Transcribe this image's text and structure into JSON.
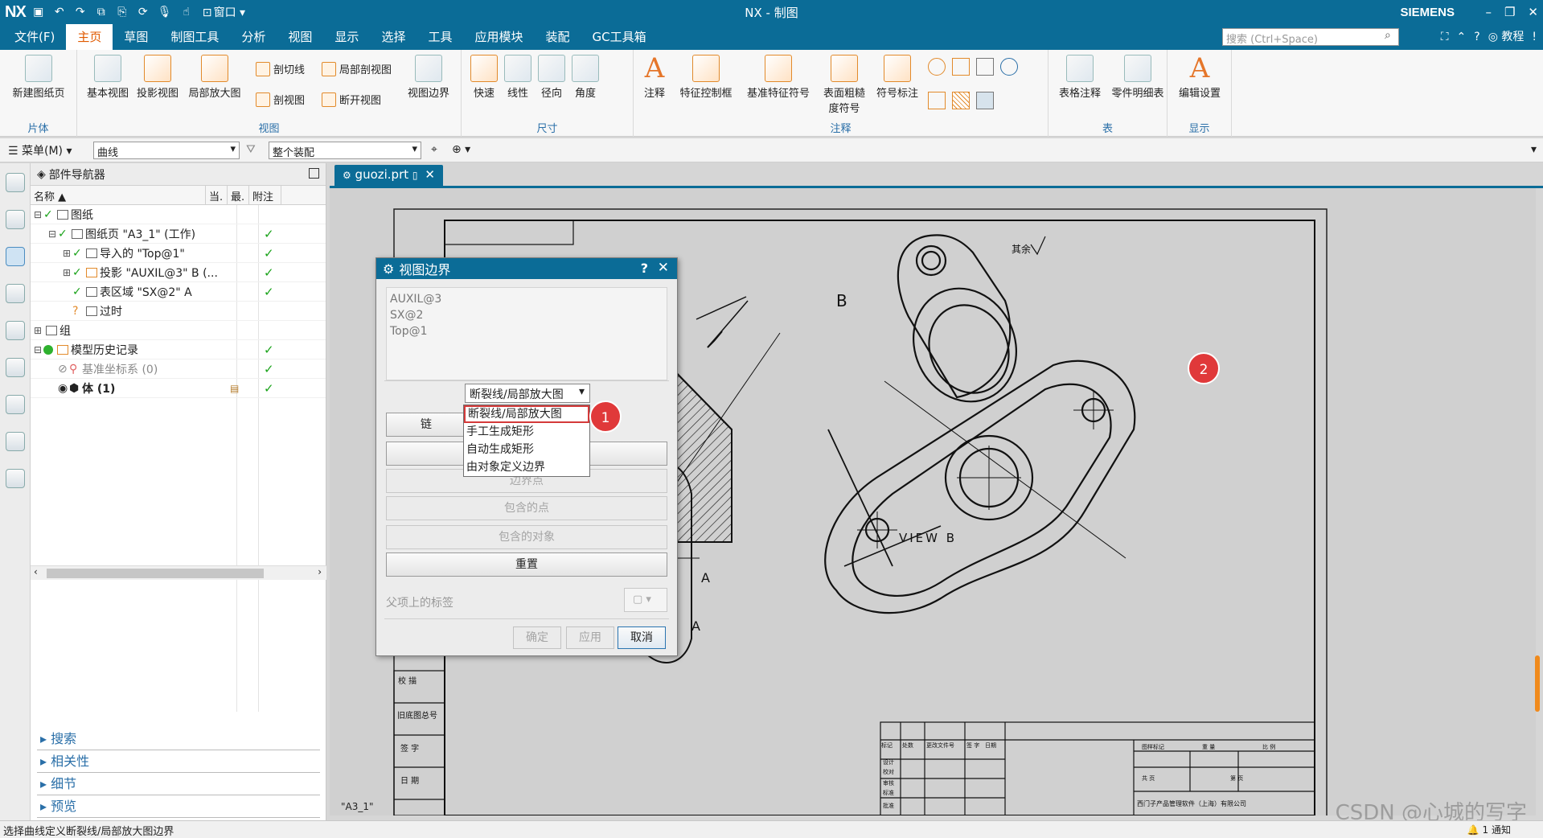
{
  "app": {
    "logo": "NX",
    "window_title": "NX - 制图",
    "brand": "SIEMENS",
    "window_menu": "窗口"
  },
  "menu_tabs": [
    "文件(F)",
    "主页",
    "草图",
    "制图工具",
    "分析",
    "视图",
    "显示",
    "选择",
    "工具",
    "应用模块",
    "装配",
    "GC工具箱"
  ],
  "search": {
    "placeholder": "搜索 (Ctrl+Space)"
  },
  "help_label": "教程",
  "ribbon": {
    "groups": [
      {
        "label": "片体"
      },
      {
        "label": "视图"
      },
      {
        "label": "尺寸"
      },
      {
        "label": "注释"
      },
      {
        "label": "表"
      },
      {
        "label": "显示"
      }
    ],
    "new_sheet": "新建图纸页",
    "base_view": "基本视图",
    "proj_view": "投影视图",
    "detail_view": "局部放大图",
    "section_line": "剖切线",
    "section_view": "剖视图",
    "broken_section": "局部剖视图",
    "broken_view": "断开视图",
    "view_boundary": "视图边界",
    "rapid": "快速",
    "linear": "线性",
    "radial": "径向",
    "angular": "角度",
    "note": "注释",
    "fcf": "特征控制框",
    "datum": "基准特征符号",
    "surface_finish_1": "表面粗糙",
    "surface_finish_2": "度符号",
    "id_symbol": "符号标注",
    "tabular_note": "表格注释",
    "parts_list": "零件明细表",
    "edit_settings": "编辑设置"
  },
  "toolbar": {
    "menu_label": "菜单(M)",
    "filter_value": "曲线",
    "scope_value": "整个装配"
  },
  "navigator": {
    "title": "部件导航器",
    "columns": [
      "名称",
      "当.",
      "最.",
      "附注"
    ],
    "rows": [
      {
        "label": "图纸"
      },
      {
        "label": "图纸页 \"A3_1\" (工作)"
      },
      {
        "label": "导入的 \"Top@1\""
      },
      {
        "label": "投影 \"AUXIL@3\" B (..."
      },
      {
        "label": "表区域 \"SX@2\" A"
      },
      {
        "label": "过时"
      },
      {
        "label": "组"
      },
      {
        "label": "模型历史记录"
      },
      {
        "label": "基准坐标系 (0)"
      },
      {
        "label": "体 (1)"
      }
    ],
    "panels": [
      "搜索",
      "相关性",
      "细节",
      "预览"
    ]
  },
  "doc_tab": {
    "name": "guozi.prt"
  },
  "drawing": {
    "view_label": "VIEW  B",
    "section_b": "B",
    "section_a": "A",
    "finish_note": "其余",
    "sheet_name": "\"A3_1\"",
    "tb_row1": "校 描",
    "tb_row2": "旧底图总号",
    "tb_row3": "签 字",
    "tb_row4": "日 期",
    "company": "西门子产品管理软件（上海）有限公司",
    "tb_stage": "图样标记",
    "tb_weight": "重 量",
    "tb_scale": "比 例",
    "tb_total": "共 页",
    "tb_page": "第 页",
    "tb_mark": "标记",
    "tb_count": "处数",
    "tb_file": "更改文件号",
    "tb_sign": "签 字",
    "tb_date": "日期",
    "tb_design": "设计",
    "tb_check": "校对",
    "tb_review": "审核",
    "tb_std": "标准",
    "tb_approve": "批准"
  },
  "dialog": {
    "title": "视图边界",
    "views": [
      "AUXIL@3",
      "SX@2",
      "Top@1"
    ],
    "type_value": "断裂线/局部放大图",
    "chain_button": "链",
    "boundary_point_button": "边界点",
    "include_point_button": "包含的点",
    "include_object_button": "包含的对象",
    "reset_button": "重置",
    "parent_label": "父项上的标签",
    "ok": "确定",
    "apply": "应用",
    "cancel": "取消"
  },
  "dropdown": {
    "options": [
      "断裂线/局部放大图",
      "手工生成矩形",
      "自动生成矩形",
      "由对象定义边界"
    ]
  },
  "badges": [
    "1",
    "2"
  ],
  "status": {
    "text": "选择曲线定义断裂线/局部放大图边界",
    "notify": "1 通知"
  },
  "watermark": "CSDN @心城的写字"
}
